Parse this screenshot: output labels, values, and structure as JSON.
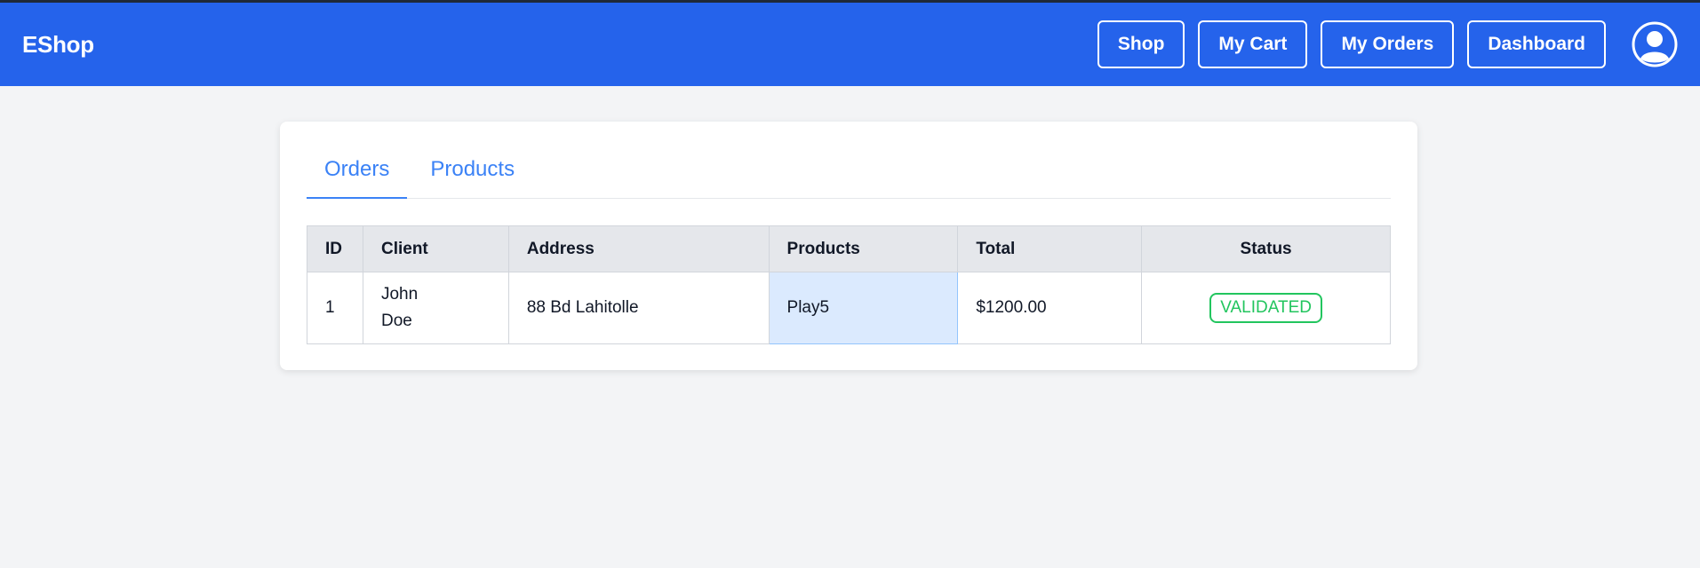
{
  "nav": {
    "brand": "EShop",
    "buttons": [
      "Shop",
      "My Cart",
      "My Orders",
      "Dashboard"
    ],
    "accent": "#2563eb"
  },
  "tabs": [
    "Orders",
    "Products"
  ],
  "table": {
    "headers": [
      "ID",
      "Client",
      "Address",
      "Products",
      "Total",
      "Status"
    ],
    "rows": [
      {
        "id": "1",
        "client": "John Doe",
        "address": "88 Bd Lahitolle",
        "products": "Play5",
        "total": "$1200.00",
        "status": "VALIDATED"
      }
    ]
  },
  "icons": {
    "avatar": "user-circle-icon"
  },
  "colors": {
    "status_validated": "#22c55e",
    "selected_cell": "#dbeafe"
  }
}
